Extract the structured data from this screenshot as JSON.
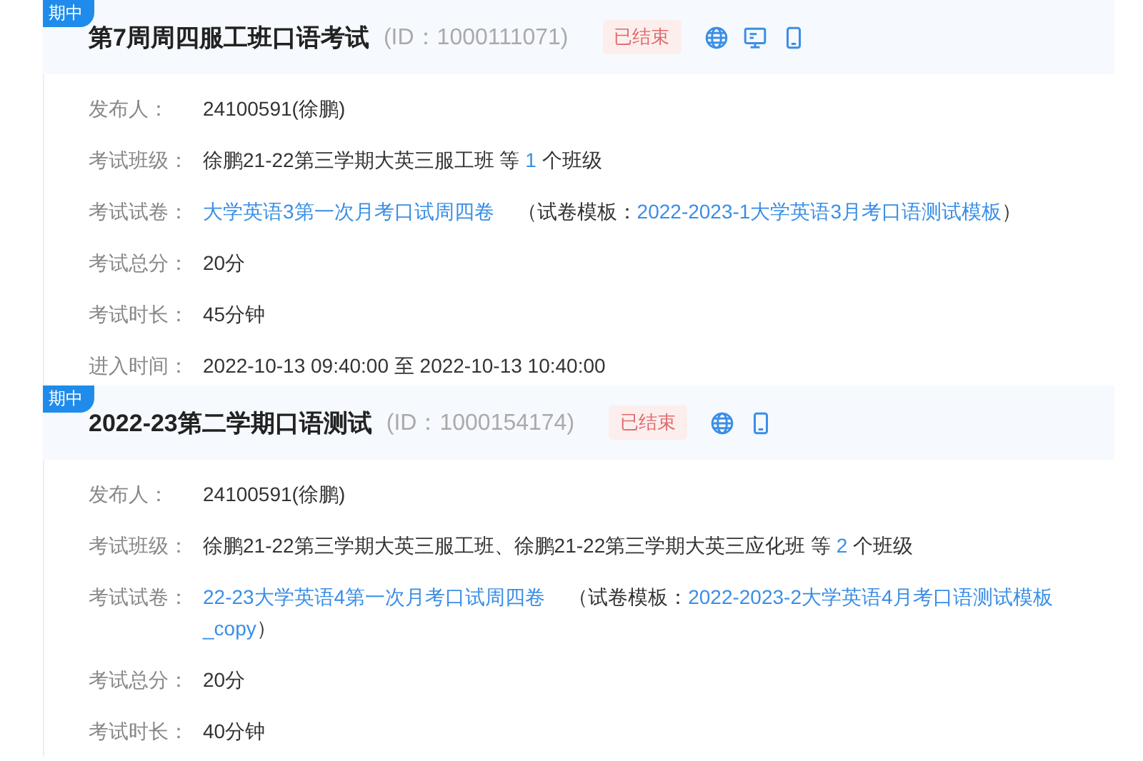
{
  "exams": [
    {
      "tag": "期中",
      "title": "第7周周四服工班口语考试",
      "id_text": "(ID：1000111071)",
      "status": "已结束",
      "platforms": [
        {
          "kind": "web"
        },
        {
          "kind": "desktop"
        },
        {
          "kind": "mobile"
        }
      ],
      "fields": [
        {
          "kind": "text",
          "label": "发布人：",
          "value": "24100591(徐鹏)"
        },
        {
          "kind": "classes",
          "label": "考试班级：",
          "prefix": "徐鹏21-22第三学期大英三服工班 等",
          "count": "1",
          "suffix": "个班级"
        },
        {
          "kind": "paper",
          "label": "考试试卷：",
          "paper": "大学英语3第一次月考口试周四卷",
          "template_label": "（试卷模板：",
          "template": "2022-2023-1大学英语3月考口语测试模板",
          "close": "）"
        },
        {
          "kind": "text",
          "label": "考试总分：",
          "value": "20分"
        },
        {
          "kind": "text",
          "label": "考试时长：",
          "value": "45分钟"
        },
        {
          "kind": "text",
          "label": "进入时间：",
          "value": "2022-10-13 09:40:00 至 2022-10-13 10:40:00"
        }
      ]
    },
    {
      "tag": "期中",
      "title": "2022-23第二学期口语测试",
      "id_text": "(ID：1000154174)",
      "status": "已结束",
      "platforms": [
        {
          "kind": "web"
        },
        {
          "kind": "mobile"
        }
      ],
      "fields": [
        {
          "kind": "text",
          "label": "发布人：",
          "value": "24100591(徐鹏)"
        },
        {
          "kind": "classes",
          "label": "考试班级：",
          "prefix": "徐鹏21-22第三学期大英三服工班、徐鹏21-22第三学期大英三应化班 等",
          "count": "2",
          "suffix": "个班级"
        },
        {
          "kind": "paper",
          "label": "考试试卷：",
          "paper": "22-23大学英语4第一次月考口试周四卷",
          "template_label": "（试卷模板：",
          "template": "2022-2023-2大学英语4月考口语测试模板_copy",
          "close": "）"
        },
        {
          "kind": "text",
          "label": "考试总分：",
          "value": "20分"
        },
        {
          "kind": "text",
          "label": "考试时长：",
          "value": "40分钟"
        }
      ]
    }
  ]
}
